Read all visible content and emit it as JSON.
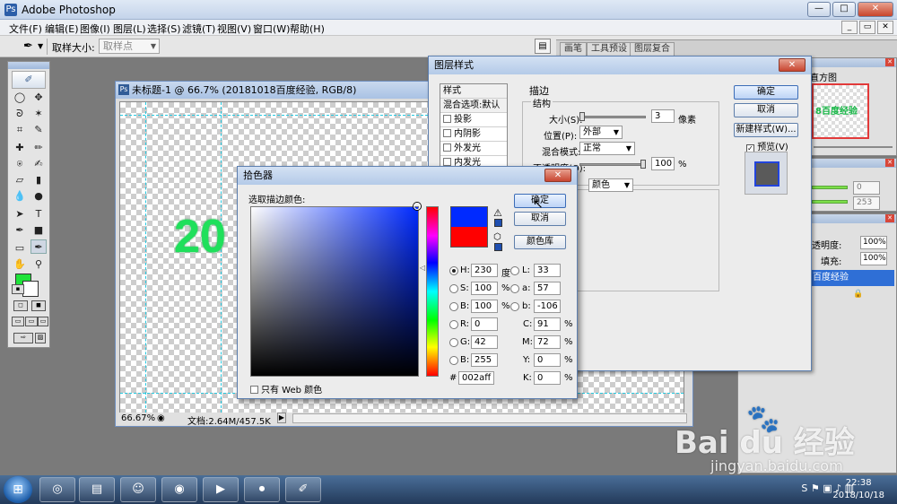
{
  "app": {
    "title": "Adobe Photoshop"
  },
  "menu": [
    "文件(F)",
    "编辑(E)",
    "图像(I)",
    "图层(L)",
    "选择(S)",
    "滤镜(T)",
    "视图(V)",
    "窗口(W)",
    "帮助(H)"
  ],
  "options_bar": {
    "sample_size_label": "取样大小:",
    "sample_size_value": "取样点",
    "well_tabs": [
      "画笔",
      "工具预设",
      "图层复合"
    ]
  },
  "colors": {
    "foreground": "#1fe33a",
    "background": "#ffffff",
    "new_color": "#002aff",
    "old_color": "#ff0000"
  },
  "document": {
    "title": "未标题-1 @ 66.7% (20181018百度经验, RGB/8)",
    "canvas_text": "20",
    "zoom": "66.67%",
    "doc_info": "文档:2.64M/457.5K"
  },
  "panels": {
    "navigator_tab": "直方图",
    "navigator_thumb_text": "8百度经验",
    "color_values": [
      "0",
      "253"
    ],
    "opacity_label": "透明度:",
    "opacity_value": "100%",
    "fill_label": "填充:",
    "fill_value": "100%",
    "layer_name": "百度经验"
  },
  "layer_style": {
    "title": "图层样式",
    "styles_header": "样式",
    "blend_default": "混合选项:默认",
    "items": [
      "投影",
      "内阴影",
      "外发光",
      "内发光"
    ],
    "section": "描边",
    "structure": "结构",
    "size_label": "大小(S):",
    "size_value": "3",
    "size_unit": "像素",
    "position_label": "位置(P):",
    "position_value": "外部",
    "blend_mode_label": "混合模式:",
    "blend_mode_value": "正常",
    "opacity_label": "不透明度(O):",
    "opacity_value": "100",
    "opacity_unit": "%",
    "fill_type_value": "颜色",
    "ok": "确定",
    "cancel": "取消",
    "new_style": "新建样式(W)...",
    "preview": "预览(V)"
  },
  "color_picker": {
    "title": "拾色器",
    "prompt": "选取描边颜色:",
    "ok": "确定",
    "cancel": "取消",
    "libraries": "颜色库",
    "H": "230",
    "H_unit": "度",
    "S": "100",
    "S_unit": "%",
    "B": "100",
    "B_unit": "%",
    "R": "0",
    "G": "42",
    "Bl": "255",
    "L": "33",
    "a": "57",
    "b": "-106",
    "C": "91",
    "M": "72",
    "Y": "0",
    "K": "0",
    "pct": "%",
    "hex_label": "#",
    "hex": "002aff",
    "web_only": "只有 Web 颜色",
    "labels": {
      "H": "H:",
      "S": "S:",
      "B": "B:",
      "R": "R:",
      "G": "G:",
      "Bl": "B:",
      "L": "L:",
      "a": "a:",
      "b": "b:",
      "C": "C:",
      "M": "M:",
      "Y": "Y:",
      "K": "K:"
    }
  },
  "taskbar": {
    "time": "22:38",
    "date": "2018/10/18"
  },
  "watermark": {
    "logo": "Bai du 经验",
    "url": "jingyan.baidu.com"
  }
}
